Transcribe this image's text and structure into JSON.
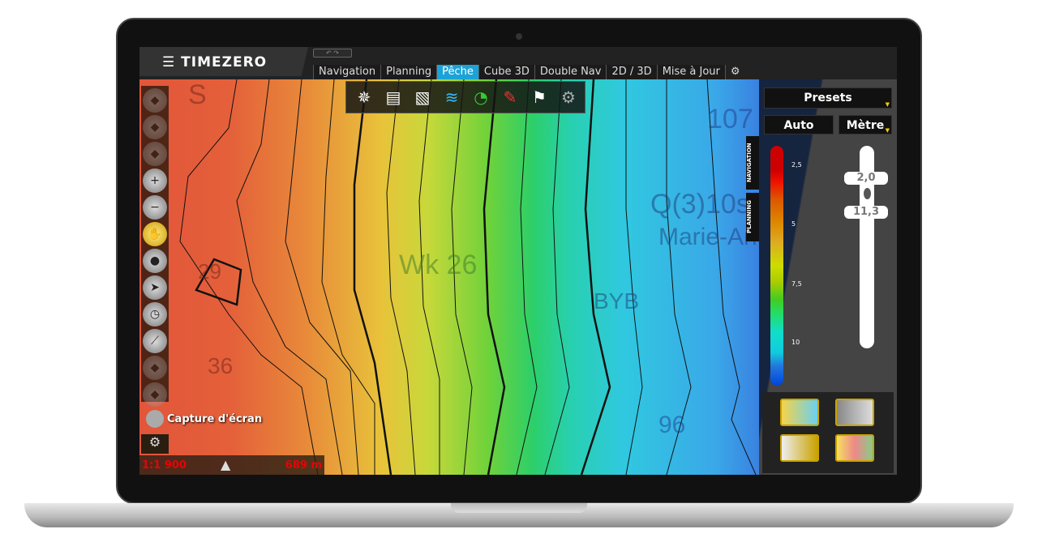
{
  "app": {
    "logo": "TIMEZERO",
    "undo_redo": "↶ ↷"
  },
  "tabs": [
    {
      "label": "Navigation"
    },
    {
      "label": "Planning"
    },
    {
      "label": "Pêche",
      "active": true
    },
    {
      "label": "Cube 3D"
    },
    {
      "label": "Double Nav"
    },
    {
      "label": "2D / 3D"
    },
    {
      "label": "Mise à Jour"
    }
  ],
  "toolbar": [
    "compass-rose-icon",
    "charts-layers-icon",
    "chart-overlay-icon",
    "sonar-icon",
    "fishing-target-icon",
    "route-pen-icon",
    "flags-icon",
    "settings-gears-icon"
  ],
  "map": {
    "labels": [
      "S",
      "29",
      "36",
      "Wk 26",
      "Q(3)10s",
      "Marie-Anne",
      "BYB",
      "107",
      "96"
    ]
  },
  "left_toolbar": {
    "capture_label": "Capture d'écran",
    "scale": "1:1 900",
    "distance": "689 m"
  },
  "panel": {
    "presets": "Presets",
    "auto": "Auto",
    "unit": "Mètre",
    "side_tabs": [
      "NAVIGATION",
      "PLANNING"
    ],
    "scale_labels": [
      "2,5",
      "5",
      "7,5",
      "10"
    ],
    "range_min": "2,0",
    "range_max": "11,3"
  },
  "colors": {
    "active_tab": "#1ba3d8",
    "scale_text": "#ee0000",
    "accent_yellow": "#f0d000"
  }
}
